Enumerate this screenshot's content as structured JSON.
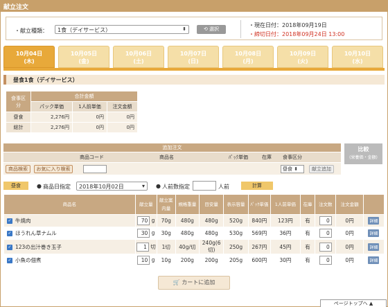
{
  "title": "献立注文",
  "selector": {
    "label": "・献立種類：",
    "value": "1食（デイサービス）",
    "button": "選択",
    "current_date": "・現在日付：2018年09月19日",
    "deadline": "・締切日付：2018年09月24日 13:00"
  },
  "tabs": [
    {
      "date": "10月04日",
      "dow": "(木)"
    },
    {
      "date": "10月05日",
      "dow": "(金)"
    },
    {
      "date": "10月06日",
      "dow": "(土)"
    },
    {
      "date": "10月07日",
      "dow": "(日)"
    },
    {
      "date": "10月08日",
      "dow": "(月)"
    },
    {
      "date": "10月09日",
      "dow": "(火)"
    },
    {
      "date": "10月10日",
      "dow": "(水)"
    }
  ],
  "section_title": "昼食1食（デイサービス）",
  "summary": {
    "h_category": "食事区分",
    "h_total": "合計金額",
    "h_pack": "パック単価",
    "h_unit": "1人前単価",
    "h_order": "注文金額",
    "rows": [
      {
        "label": "昼食",
        "pack": "2,276円",
        "unit": "0円",
        "order": "0円"
      },
      {
        "label": "総計",
        "pack": "2,276円",
        "unit": "0円",
        "order": "0円"
      }
    ]
  },
  "add_order": {
    "title": "追加注文",
    "col_code": "商品コード",
    "col_name": "商品名",
    "col_pack": "ﾊﾟｯｸ単価",
    "col_stock": "在庫",
    "col_cat": "食事区分",
    "btn_search": "商品検索",
    "btn_fav": "お気に入り検索",
    "cat_value": "昼食",
    "btn_add": "献立追加"
  },
  "compare": {
    "label": "比較",
    "sub": "(栄養価・金額)"
  },
  "filter": {
    "meal": "昼食",
    "date_label": "商品日指定",
    "date_value": "2018年10月02日",
    "persons_label": "人前数指定",
    "persons_unit": "人前",
    "calc": "計算"
  },
  "table": {
    "headers": [
      "商品名",
      "献立量",
      "献立案内量",
      "規格重量",
      "目安量",
      "表示容量",
      "ﾊﾟｯｸ単価",
      "1人前単価",
      "在庫",
      "注文数",
      "注文金額",
      ""
    ],
    "rows": [
      {
        "name": "牛焼肉",
        "qty": "70",
        "unit": "g",
        "guide": "70g",
        "spec": "480g",
        "est": "480g",
        "disp": "520g",
        "pack": "840円",
        "per": "123円",
        "stock": "有",
        "order": "0",
        "amount": "0円",
        "detail": "詳細"
      },
      {
        "name": "ほうれん草ナムル",
        "qty": "30",
        "unit": "g",
        "guide": "30g",
        "spec": "480g",
        "est": "480g",
        "disp": "530g",
        "pack": "569円",
        "per": "36円",
        "stock": "有",
        "order": "0",
        "amount": "0円",
        "detail": "詳細"
      },
      {
        "name": "123の出汁巻き玉子",
        "qty": "1",
        "unit": "切",
        "guide": "1切",
        "spec": "40g/切",
        "est": "240g(6切)",
        "disp": "250g",
        "pack": "267円",
        "per": "45円",
        "stock": "有",
        "order": "0",
        "amount": "0円",
        "detail": "詳細"
      },
      {
        "name": "小魚の佃煮",
        "qty": "10",
        "unit": "g",
        "guide": "10g",
        "spec": "200g",
        "est": "200g",
        "disp": "205g",
        "pack": "600円",
        "per": "30円",
        "stock": "有",
        "order": "0",
        "amount": "0円",
        "detail": "詳細"
      }
    ]
  },
  "cart_button": "カートに追加",
  "page_top": "ページトップへ ▲"
}
